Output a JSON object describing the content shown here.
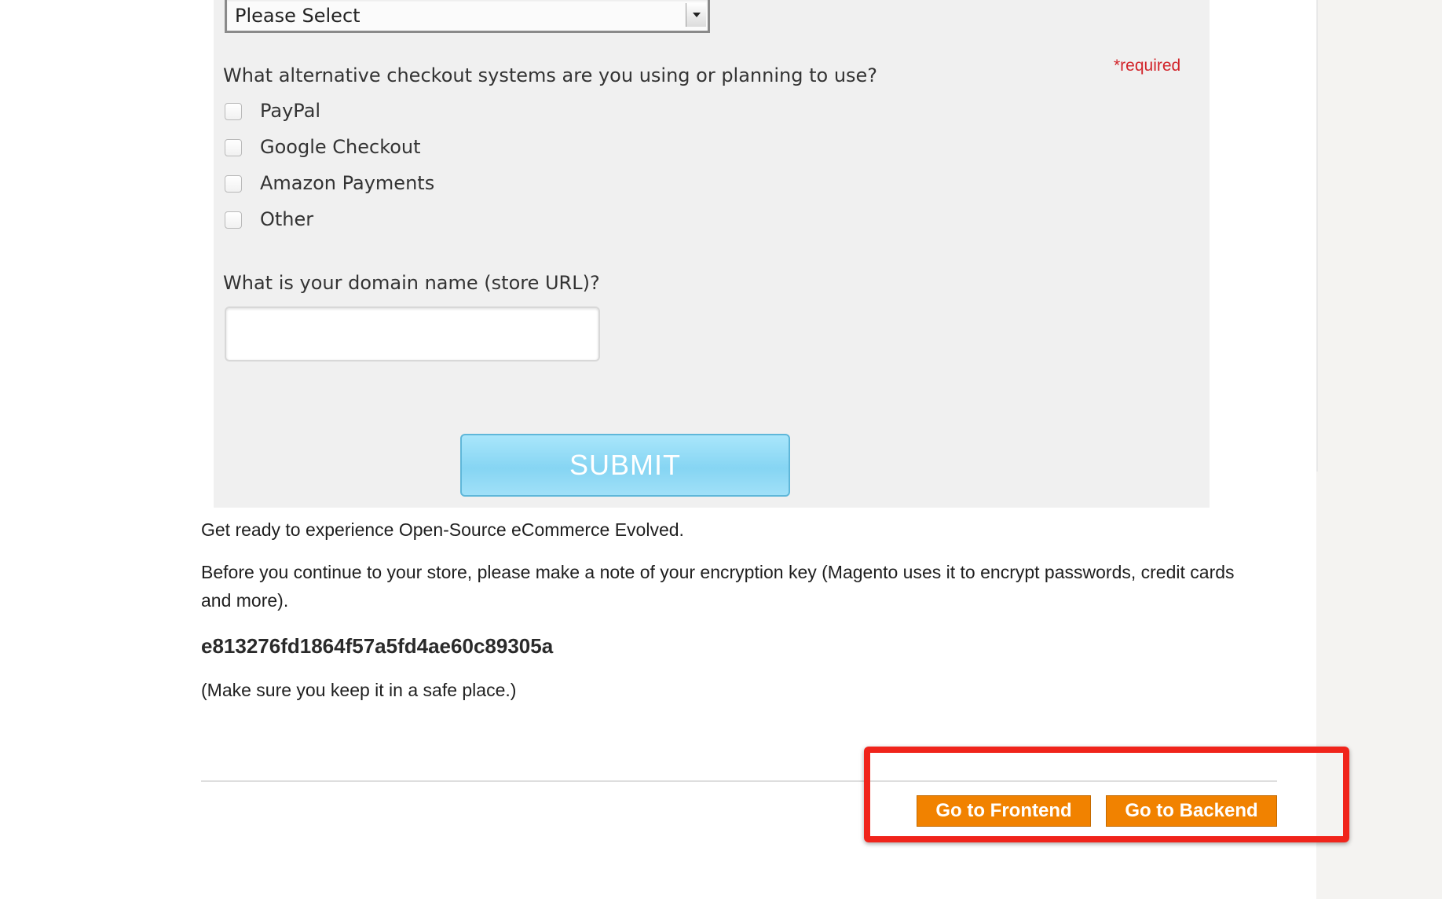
{
  "form": {
    "select_value": "Please Select",
    "checkout_question": "What alternative checkout systems are you using or planning to use?",
    "required_label": "*required",
    "checkout_options": [
      {
        "label": "PayPal",
        "checked": false
      },
      {
        "label": "Google Checkout",
        "checked": false
      },
      {
        "label": "Amazon Payments",
        "checked": false
      },
      {
        "label": "Other",
        "checked": false
      }
    ],
    "domain_question": "What is your domain name (store URL)?",
    "domain_value": "",
    "submit_label": "SUBMIT"
  },
  "content": {
    "intro": "Get ready to experience Open-Source eCommerce Evolved.",
    "note": "Before you continue to your store, please make a note of your encryption key (Magento uses it to encrypt passwords, credit cards and more).",
    "encryption_key": "e813276fd1864f57a5fd4ae60c89305a",
    "safe_note": "(Make sure you keep it in a safe place.)"
  },
  "actions": {
    "frontend_label": "Go to Frontend",
    "backend_label": "Go to Backend"
  },
  "colors": {
    "action_button": "#f18200",
    "highlight_border": "#f0241b",
    "required_text": "#d2242a",
    "submit_button": "#86d5f3"
  }
}
